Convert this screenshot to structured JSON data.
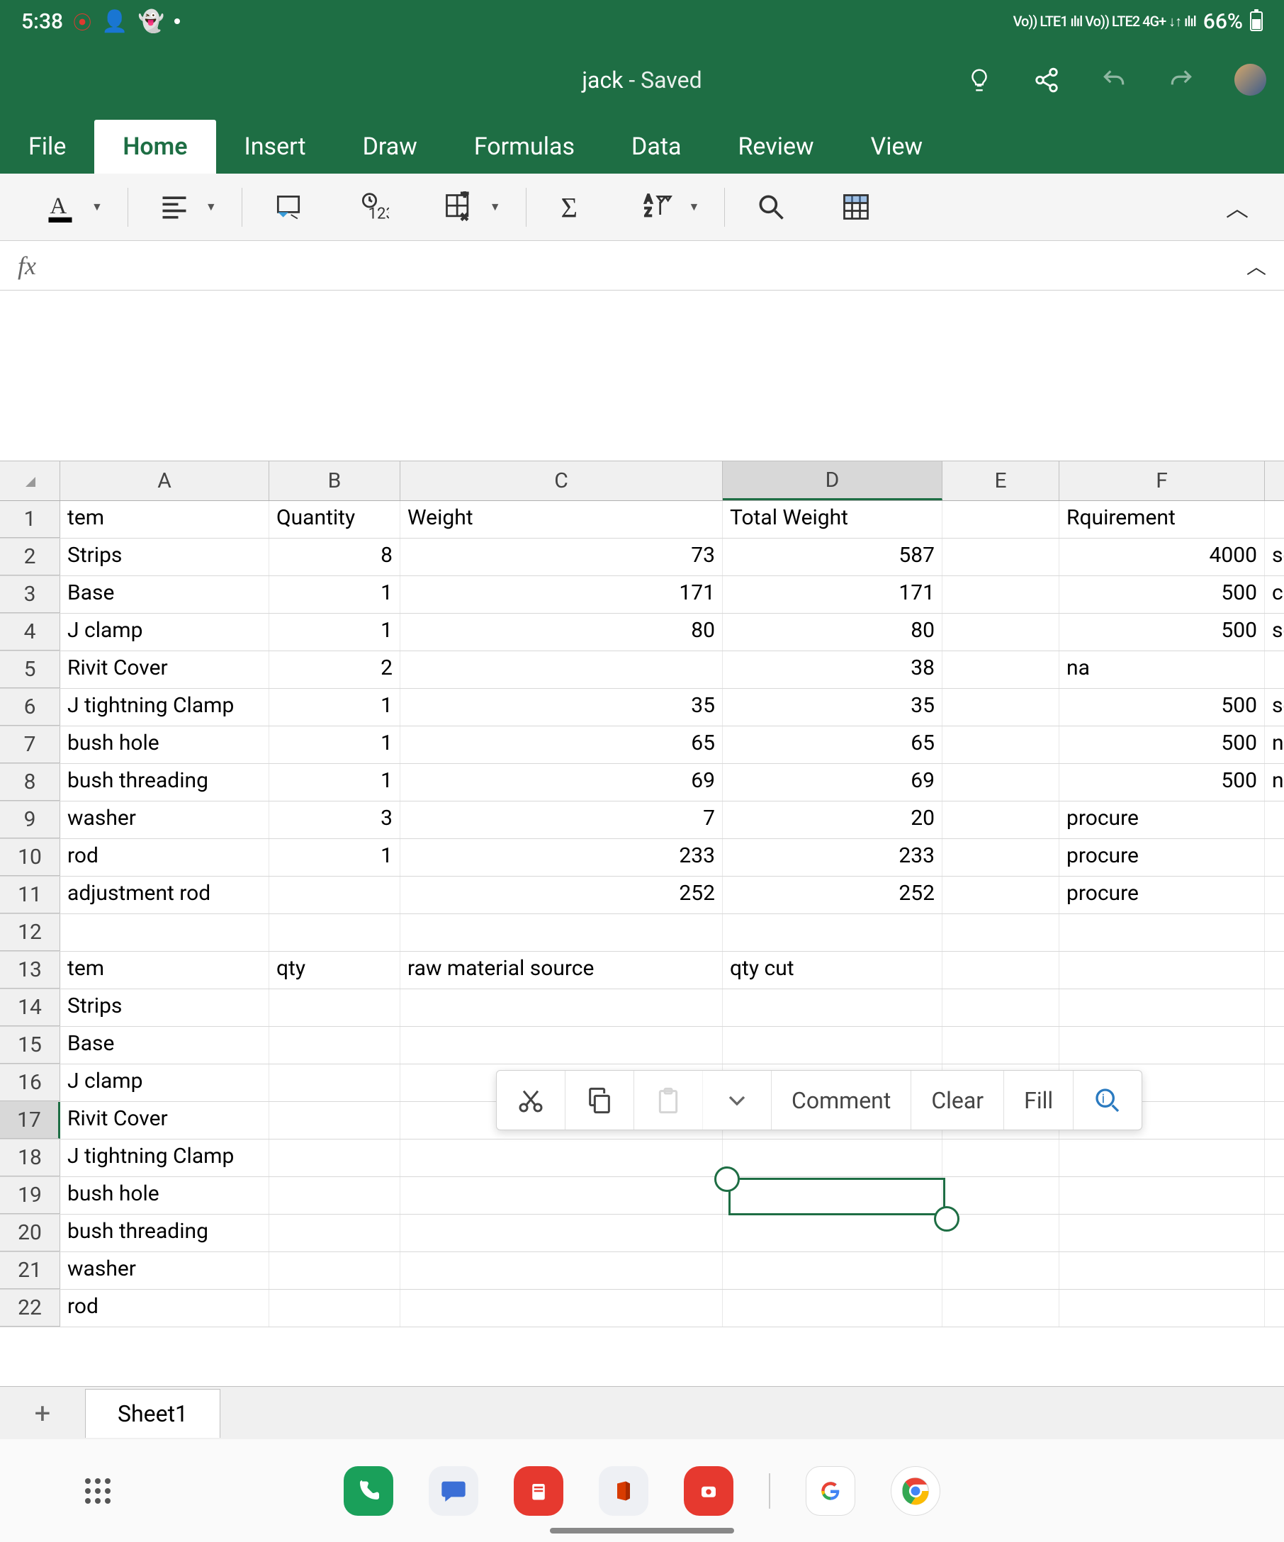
{
  "status": {
    "time": "5:38",
    "signal_text": "Vo)) LTE1 ılıl Vo)) LTE2 4G+ ↓↑ ılıl",
    "battery": "66%"
  },
  "title": {
    "doc_name": "jack",
    "saved_label": "- Saved"
  },
  "tabs": [
    "File",
    "Home",
    "Insert",
    "Draw",
    "Formulas",
    "Data",
    "Review",
    "View"
  ],
  "active_tab_index": 1,
  "context_bar": {
    "comment": "Comment",
    "clear": "Clear",
    "fill": "Fill"
  },
  "columns": [
    "A",
    "B",
    "C",
    "D",
    "E",
    "F"
  ],
  "selected_column": "D",
  "selected_row": 17,
  "rows": [
    {
      "n": 1,
      "A": "tem",
      "B": "Quantity",
      "C": "Weight",
      "D": "Total Weight",
      "E": "",
      "F": "Rquirement",
      "G": ""
    },
    {
      "n": 2,
      "A": "Strips",
      "B": "8",
      "C": "73",
      "D": "587",
      "E": "",
      "F": "4000",
      "G": "sc"
    },
    {
      "n": 3,
      "A": "Base",
      "B": "1",
      "C": "171",
      "D": "171",
      "E": "",
      "F": "500",
      "G": "cu"
    },
    {
      "n": 4,
      "A": "J clamp",
      "B": "1",
      "C": "80",
      "D": "80",
      "E": "",
      "F": "500",
      "G": "sc"
    },
    {
      "n": 5,
      "A": "Rivit Cover",
      "B": "2",
      "C": "",
      "D": "38",
      "E": "",
      "F": "na",
      "G": ""
    },
    {
      "n": 6,
      "A": "J tightning Clamp",
      "B": "1",
      "C": "35",
      "D": "35",
      "E": "",
      "F": "500",
      "G": "sc"
    },
    {
      "n": 7,
      "A": "bush hole",
      "B": "1",
      "C": "65",
      "D": "65",
      "E": "",
      "F": "500",
      "G": "na"
    },
    {
      "n": 8,
      "A": "bush threading",
      "B": "1",
      "C": "69",
      "D": "69",
      "E": "",
      "F": "500",
      "G": "na"
    },
    {
      "n": 9,
      "A": "washer",
      "B": "3",
      "C": "7",
      "D": "20",
      "E": "",
      "F": "procure",
      "G": ""
    },
    {
      "n": 10,
      "A": "rod",
      "B": "1",
      "C": "233",
      "D": "233",
      "E": "",
      "F": "procure",
      "G": ""
    },
    {
      "n": 11,
      "A": "adjustment rod",
      "B": "",
      "C": "252",
      "D": "252",
      "E": "",
      "F": "procure",
      "G": ""
    },
    {
      "n": 12,
      "A": "",
      "B": "",
      "C": "",
      "D": "",
      "E": "",
      "F": "",
      "G": ""
    },
    {
      "n": 13,
      "A": "tem",
      "B": "qty",
      "C": "raw material source",
      "D": "qty cut",
      "E": "",
      "F": "",
      "G": ""
    },
    {
      "n": 14,
      "A": "Strips",
      "B": "",
      "C": "",
      "D": "",
      "E": "",
      "F": "",
      "G": ""
    },
    {
      "n": 15,
      "A": "Base",
      "B": "",
      "C": "",
      "D": "",
      "E": "",
      "F": "",
      "G": ""
    },
    {
      "n": 16,
      "A": "J clamp",
      "B": "",
      "C": "",
      "D": "",
      "E": "",
      "F": "",
      "G": ""
    },
    {
      "n": 17,
      "A": "Rivit Cover",
      "B": "",
      "C": "",
      "D": "",
      "E": "",
      "F": "",
      "G": ""
    },
    {
      "n": 18,
      "A": "J tightning Clamp",
      "B": "",
      "C": "",
      "D": "",
      "E": "",
      "F": "",
      "G": ""
    },
    {
      "n": 19,
      "A": "bush hole",
      "B": "",
      "C": "",
      "D": "",
      "E": "",
      "F": "",
      "G": ""
    },
    {
      "n": 20,
      "A": "bush threading",
      "B": "",
      "C": "",
      "D": "",
      "E": "",
      "F": "",
      "G": ""
    },
    {
      "n": 21,
      "A": "washer",
      "B": "",
      "C": "",
      "D": "",
      "E": "",
      "F": "",
      "G": ""
    },
    {
      "n": 22,
      "A": "rod",
      "B": "",
      "C": "",
      "D": "",
      "E": "",
      "F": "",
      "G": ""
    }
  ],
  "sheets": {
    "active": "Sheet1"
  }
}
